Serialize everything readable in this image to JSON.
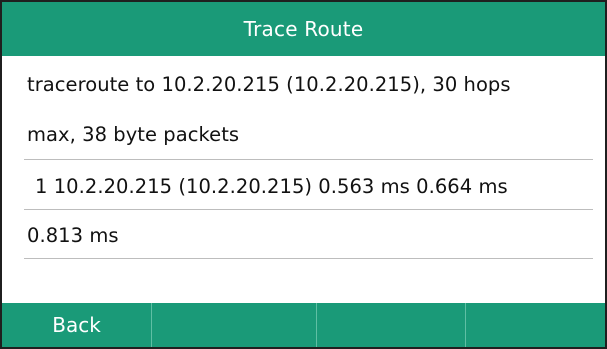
{
  "title": "Trace Route",
  "output_lines": [
    "traceroute to 10.2.20.215 (10.2.20.215), 30 hops",
    "max, 38 byte packets",
    "1  10.2.20.215 (10.2.20.215)  0.563 ms  0.664 ms",
    "0.813 ms"
  ],
  "softkeys": [
    "Back",
    "",
    "",
    ""
  ],
  "colors": {
    "accent": "#1a9a78",
    "divider": "#bdbdbd",
    "text": "#111111"
  }
}
